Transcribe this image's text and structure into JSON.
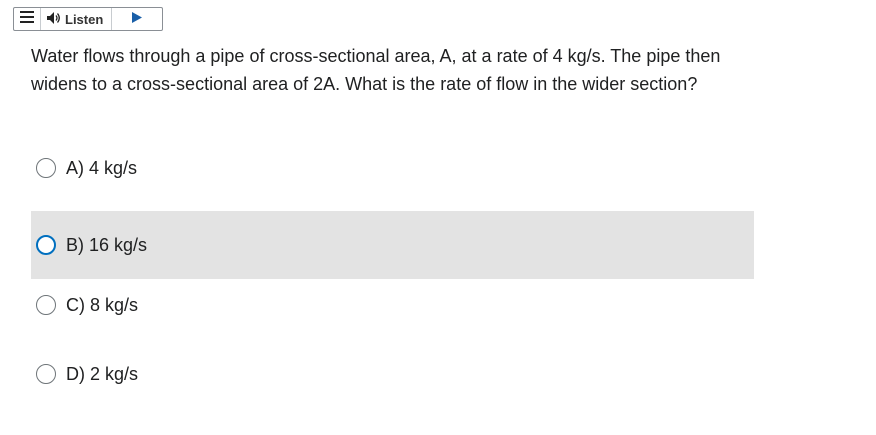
{
  "toolbar": {
    "menu_icon": "menu-icon",
    "speaker_icon": "speaker-icon",
    "listen_label": "Listen",
    "play_icon": "play-icon"
  },
  "question": {
    "text": "Water flows through a pipe of cross-sectional area, A, at a rate of 4 kg/s.  The pipe then widens to a cross-sectional area of 2A.  What is the rate of flow in the wider section?"
  },
  "options": [
    {
      "label": "A) 4 kg/s",
      "state": "default"
    },
    {
      "label": "B) 16 kg/s",
      "state": "hover"
    },
    {
      "label": "C) 8 kg/s",
      "state": "default"
    },
    {
      "label": "D) 2 kg/s",
      "state": "default"
    }
  ],
  "colors": {
    "hover_bg": "#e3e3e3",
    "focus_ring": "#006fbf",
    "play": "#1a5fa8"
  }
}
